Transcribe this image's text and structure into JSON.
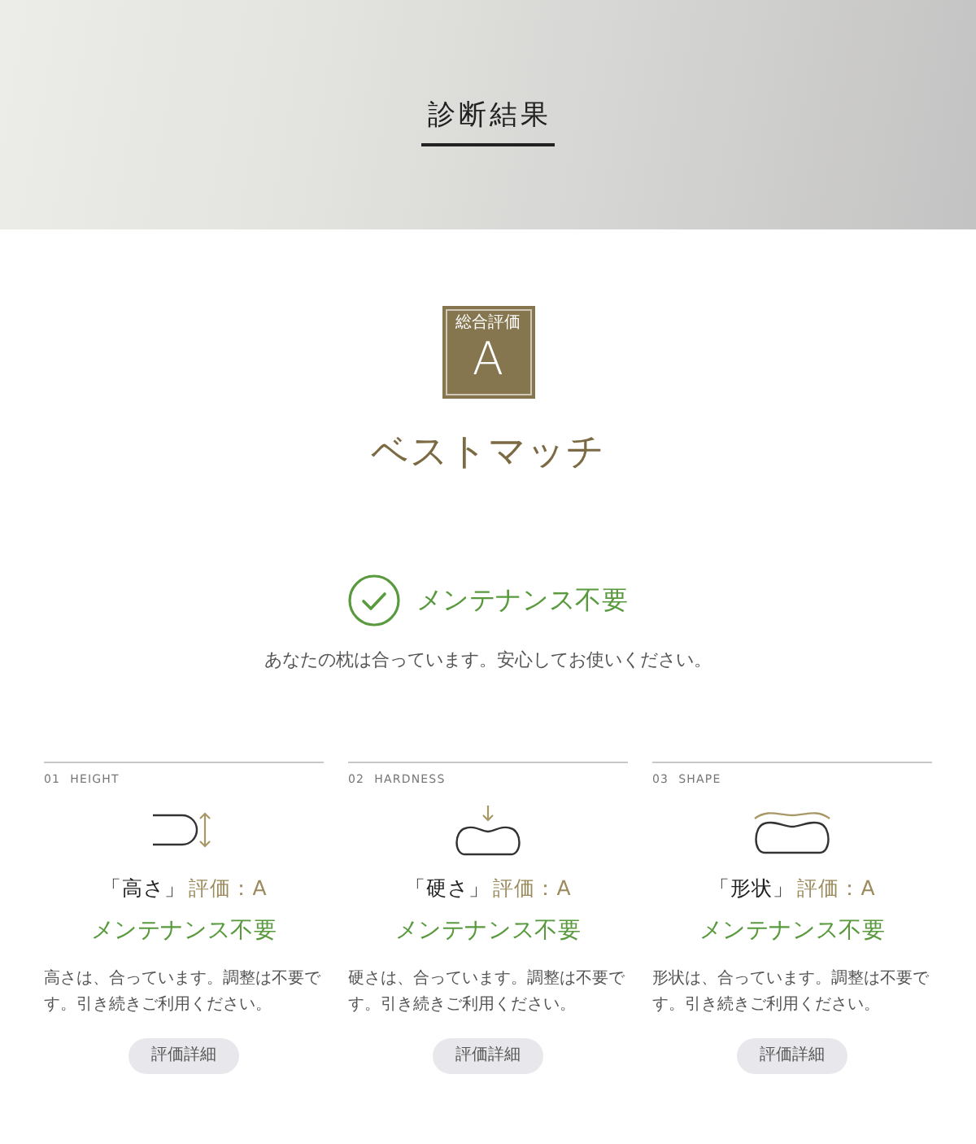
{
  "header": {
    "title": "診断結果"
  },
  "overall": {
    "label": "総合評価",
    "grade": "A",
    "verdict": "ベストマッチ"
  },
  "status": {
    "kind": "ok",
    "title": "メンテナンス不要",
    "message": "あなたの枕は合っています。安心してお使いください。"
  },
  "aspects": [
    {
      "kind": "height",
      "number": "01",
      "name": "HEIGHT",
      "label": "「高さ」",
      "grade": "評価：A",
      "status": "メンテナンス不要",
      "description": "高さは、合っています。調整は不要です。引き続きご利用ください。",
      "button": "評価詳細"
    },
    {
      "kind": "hardness",
      "number": "02",
      "name": "HARDNESS",
      "label": "「硬さ」",
      "grade": "評価：A",
      "status": "メンテナンス不要",
      "description": "硬さは、合っています。調整は不要です。引き続きご利用ください。",
      "button": "評価詳細"
    },
    {
      "kind": "shape",
      "number": "03",
      "name": "SHAPE",
      "label": "「形状」",
      "grade": "評価：A",
      "status": "メンテナンス不要",
      "description": "形状は、合っています。調整は不要です。引き続きご利用ください。",
      "button": "評価詳細"
    }
  ]
}
